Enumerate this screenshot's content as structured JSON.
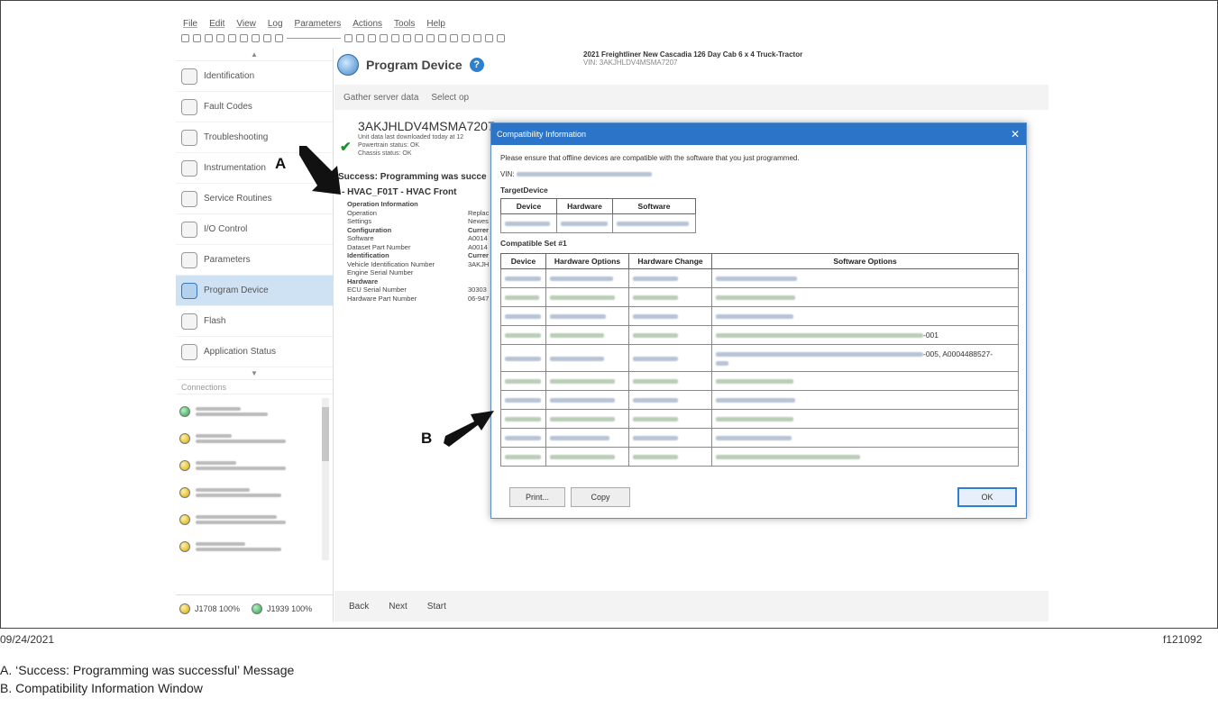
{
  "menu": [
    "File",
    "Edit",
    "View",
    "Log",
    "Parameters",
    "Actions",
    "Tools",
    "Help"
  ],
  "sidebar": {
    "items": [
      {
        "label": "Identification",
        "icon": "id-card-icon"
      },
      {
        "label": "Fault Codes",
        "icon": "fault-codes-icon"
      },
      {
        "label": "Troubleshooting",
        "icon": "troubleshooting-icon"
      },
      {
        "label": "Instrumentation",
        "icon": "instrumentation-icon"
      },
      {
        "label": "Service Routines",
        "icon": "service-routines-icon"
      },
      {
        "label": "I/O Control",
        "icon": "io-control-icon"
      },
      {
        "label": "Parameters",
        "icon": "parameters-icon"
      },
      {
        "label": "Program Device",
        "icon": "program-device-icon",
        "active": true
      },
      {
        "label": "Flash",
        "icon": "flash-icon"
      },
      {
        "label": "Application Status",
        "icon": "application-status-icon"
      }
    ],
    "connections_label": "Connections",
    "status": {
      "j1708": "J1708 100%",
      "j1939": "J1939 100%"
    }
  },
  "main": {
    "title": "Program Device",
    "vehicle_name": "2021 Freightliner New Cascadia 126 Day Cab 6 x 4 Truck-Tractor",
    "vehicle_vin": "VIN: 3AKJHLDV4MSMA7207",
    "steps": [
      "Gather server data",
      "Select op"
    ],
    "vin_title": "3AKJHLDV4MSMA7207 -",
    "unit_data": "Unit data last downloaded today at 12",
    "powertrain": "Powertrain status: OK",
    "chassis": "Chassis status: OK",
    "success": "Success: Programming was succe",
    "hvac": "-   HVAC_F01T - HVAC Front",
    "operations": [
      {
        "k": "Operation Information",
        "v": "",
        "h": true
      },
      {
        "k": "Operation",
        "v": "Replac"
      },
      {
        "k": "Settings",
        "v": "Newes"
      },
      {
        "k": "Configuration",
        "v": "Currer",
        "h": true
      },
      {
        "k": "Software",
        "v": "A0014"
      },
      {
        "k": "Dataset Part Number",
        "v": "A0014"
      },
      {
        "k": "Identification",
        "v": "Currer",
        "h": true
      },
      {
        "k": "Vehicle Identification Number",
        "v": "3AKJH"
      },
      {
        "k": "Engine Serial Number",
        "v": ""
      },
      {
        "k": "Hardware",
        "v": "",
        "h": true
      },
      {
        "k": "ECU Serial Number",
        "v": "30303"
      },
      {
        "k": "Hardware Part Number",
        "v": "06-947"
      }
    ],
    "buttons": {
      "back": "Back",
      "next": "Next",
      "start": "Start"
    }
  },
  "dialog": {
    "title": "Compatibility Information",
    "close": "✕",
    "message": "Please ensure that offline devices are compatible with the software that you just programmed.",
    "vin_label": "VIN:",
    "target_label": "TargetDevice",
    "target_headers": [
      "Device",
      "Hardware",
      "Software"
    ],
    "set_label": "Compatible Set #1",
    "set_headers": [
      "Device",
      "Hardware Options",
      "Hardware Change",
      "Software Options"
    ],
    "row_suffixes": [
      "",
      "",
      "",
      "-001",
      "-005, A0004488527-",
      "",
      "",
      "",
      "",
      ""
    ],
    "buttons": {
      "print": "Print...",
      "copy": "Copy",
      "ok": "OK"
    }
  },
  "callouts": {
    "a": "A",
    "b": "B"
  },
  "footer": {
    "date": "09/24/2021",
    "code": "f121092",
    "legend": [
      {
        "letter": "A.",
        "text": "‘Success: Programming was successful’ Message"
      },
      {
        "letter": "B.",
        "text": "Compatibility Information Window"
      }
    ]
  }
}
